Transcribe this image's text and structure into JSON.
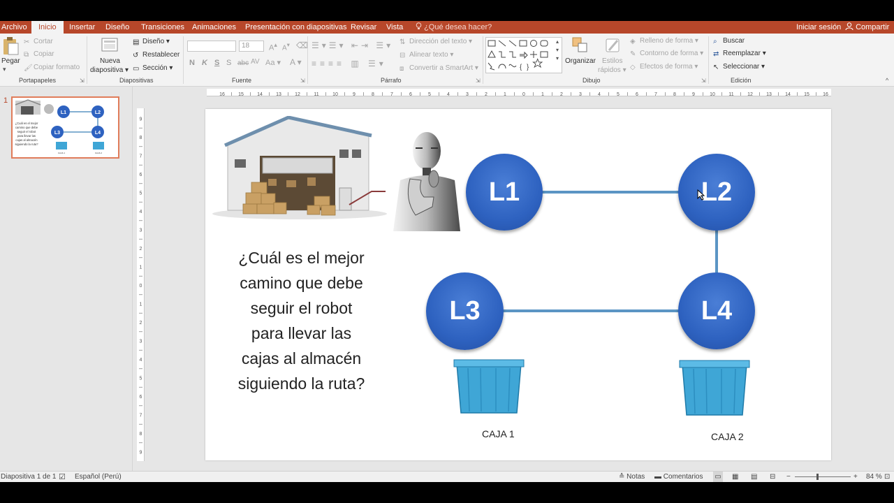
{
  "tabs": {
    "file": "Archivo",
    "home": "Inicio",
    "insert": "Insertar",
    "design": "Diseño",
    "transitions": "Transiciones",
    "animations": "Animaciones",
    "slideshow": "Presentación con diapositivas",
    "review": "Revisar",
    "view": "Vista",
    "tell_me": "¿Qué desea hacer?",
    "sign_in": "Iniciar sesión",
    "share": "Compartir"
  },
  "ribbon": {
    "clipboard": {
      "label": "Portapapeles",
      "paste": "Pegar",
      "cut": "Cortar",
      "copy": "Copiar",
      "format_painter": "Copiar formato"
    },
    "slides": {
      "label": "Diapositivas",
      "new_slide_1": "Nueva",
      "new_slide_2": "diapositiva",
      "layout": "Diseño",
      "reset": "Restablecer",
      "section": "Sección"
    },
    "font": {
      "label": "Fuente",
      "size": "18",
      "bold": "N",
      "italic": "K",
      "underline": "S",
      "strike": "S"
    },
    "paragraph": {
      "label": "Párrafo",
      "text_direction": "Dirección del texto",
      "align_text": "Alinear texto",
      "smartart": "Convertir a SmartArt"
    },
    "drawing": {
      "label": "Dibujo",
      "arrange": "Organizar",
      "quick_styles_1": "Estilos",
      "quick_styles_2": "rápidos",
      "shape_fill": "Relleno de forma",
      "shape_outline": "Contorno de forma",
      "shape_effects": "Efectos de forma"
    },
    "editing": {
      "label": "Edición",
      "find": "Buscar",
      "replace": "Reemplazar",
      "select": "Seleccionar"
    }
  },
  "thumbnail": {
    "number": "1"
  },
  "ruler": {
    "h_ticks": [
      "16",
      "15",
      "14",
      "13",
      "12",
      "11",
      "10",
      "9",
      "8",
      "7",
      "6",
      "5",
      "4",
      "3",
      "2",
      "1",
      "0",
      "1",
      "2",
      "3",
      "4",
      "5",
      "6",
      "7",
      "8",
      "9",
      "10",
      "11",
      "12",
      "13",
      "14",
      "15",
      "16"
    ],
    "v_ticks": [
      "9",
      "8",
      "7",
      "6",
      "5",
      "4",
      "3",
      "2",
      "1",
      "0",
      "1",
      "2",
      "3",
      "4",
      "5",
      "6",
      "7",
      "8",
      "9"
    ]
  },
  "slide": {
    "nodes": [
      "L1",
      "L2",
      "L3",
      "L4"
    ],
    "question_lines": [
      "¿Cuál es el mejor",
      "camino que debe",
      "seguir el robot",
      "para llevar las",
      "cajas al almacén",
      "siguiendo la ruta?"
    ],
    "box1_label": "CAJA 1",
    "box2_label": "CAJA 2",
    "node_color": "#2e62c0",
    "edge_color": "#5b95c4"
  },
  "status": {
    "slide_info": "Diapositiva 1 de 1",
    "language": "Español (Perú)",
    "notes": "Notas",
    "comments": "Comentarios",
    "zoom": "84 %"
  }
}
